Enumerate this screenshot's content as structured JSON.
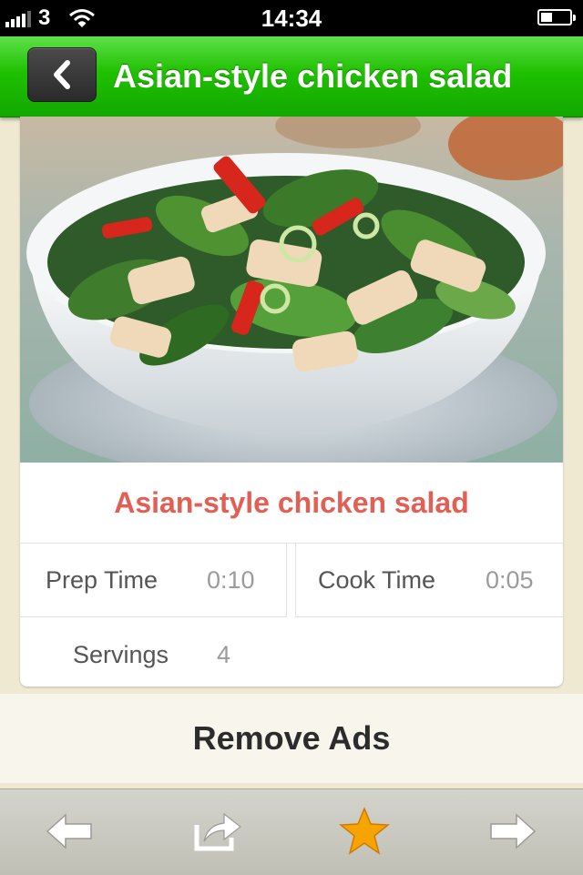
{
  "status_bar": {
    "carrier": "3",
    "time": "14:34"
  },
  "nav": {
    "title": "Asian-style chicken salad",
    "back_icon": "chevron-left-icon"
  },
  "recipe": {
    "title": "Asian-style chicken salad",
    "prep_label": "Prep Time",
    "prep_value": "0:10",
    "cook_label": "Cook Time",
    "cook_value": "0:05",
    "servings_label": "Servings",
    "servings_value": "4"
  },
  "ads": {
    "label": "Remove Ads"
  },
  "toolbar": {
    "icons": [
      "arrow-left-icon",
      "share-icon",
      "star-icon",
      "arrow-right-icon"
    ]
  },
  "colors": {
    "nav_green": "#1fc000",
    "title_red": "#e15f55",
    "star_orange": "#f7a400"
  }
}
